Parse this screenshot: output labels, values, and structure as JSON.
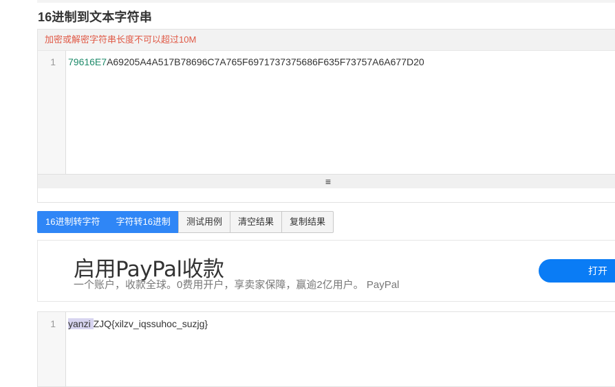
{
  "page": {
    "title": "16进制到文本字符串"
  },
  "input_panel": {
    "hint": "加密或解密字符串长度不可以超过10M",
    "line_number": "1",
    "code_prefix": "79616E7",
    "code_rest": "A69205A4A517B78696C7A765F6971737375686F635F73757A6A677D20",
    "resize_icon": "menu-lines-icon",
    "resize_glyph": "≡"
  },
  "buttons": {
    "hex_to_text": "16进制转字符",
    "text_to_hex": "字符转16进制",
    "test_example": "测试用例",
    "clear_result": "清空结果",
    "copy_result": "复制结果"
  },
  "ad": {
    "title": "启用PayPal收款",
    "subtitle": "一个账户，收款全球。0费用开户，享卖家保障，赢逾2亿用户。 PayPal",
    "button_label": "打开"
  },
  "result_panel": {
    "line_number": "1",
    "selected_text": "yanzi ",
    "rest_text": "ZJQ{xilzv_iqssuhoc_suzjg}"
  },
  "colors": {
    "primary": "#2f86f6",
    "hint_red": "#e05a47",
    "ad_button": "#0a7cf5",
    "selection": "#d7d4f0"
  }
}
